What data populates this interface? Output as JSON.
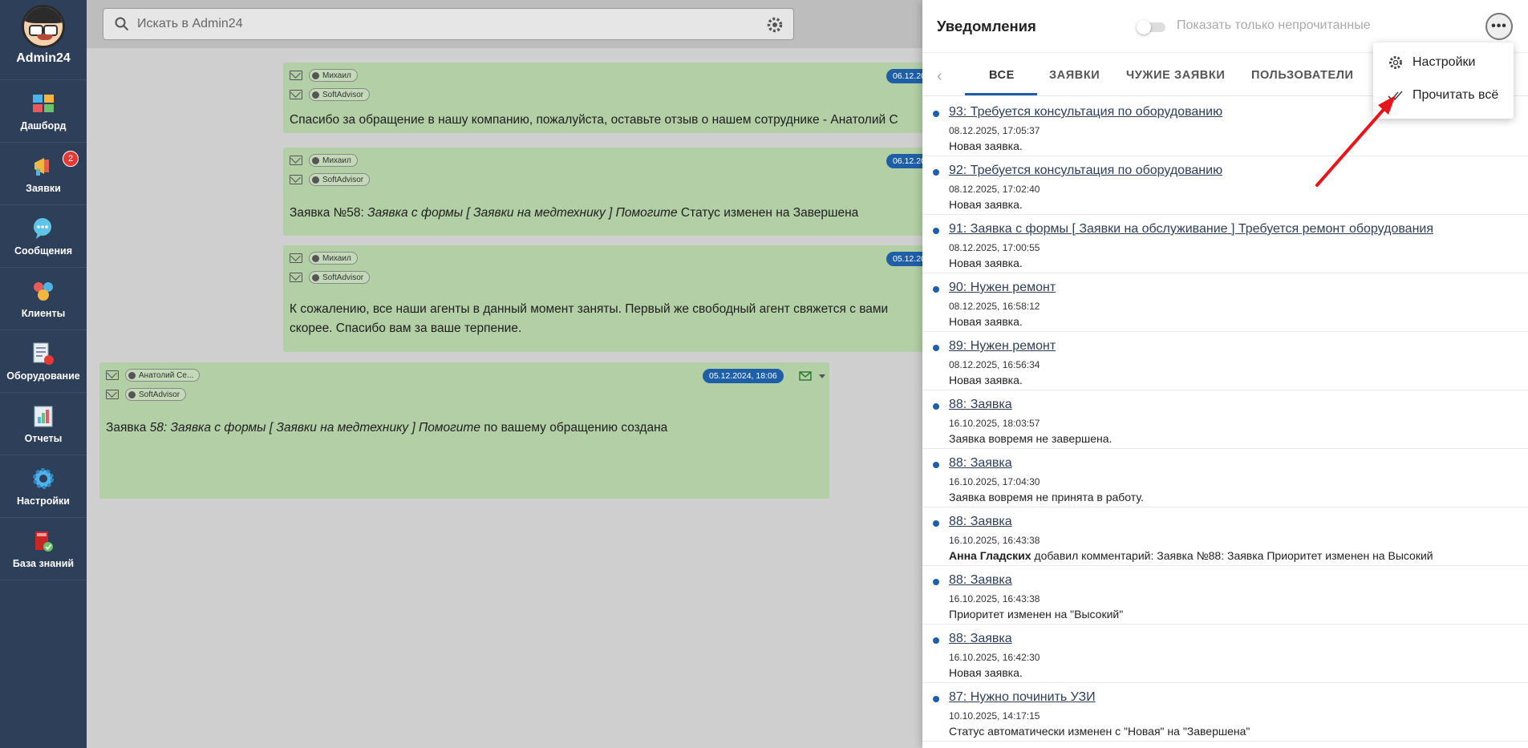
{
  "app": {
    "title": "Admin24"
  },
  "sidebar": {
    "items": [
      {
        "label": "Дашборд",
        "icon": "dashboard-icon"
      },
      {
        "label": "Заявки",
        "icon": "megaphone-icon",
        "badge": "2"
      },
      {
        "label": "Сообщения",
        "icon": "chat-bubble-icon"
      },
      {
        "label": "Клиенты",
        "icon": "clients-icon"
      },
      {
        "label": "Оборудование",
        "icon": "equipment-icon"
      },
      {
        "label": "Отчеты",
        "icon": "reports-icon"
      },
      {
        "label": "Настройки",
        "icon": "gear-icon"
      },
      {
        "label": "База знаний",
        "icon": "knowledge-base-icon"
      }
    ]
  },
  "search": {
    "placeholder": "Искать в Admin24"
  },
  "chat": {
    "messages": [
      {
        "from": "Михаил",
        "to": "SoftAdvisor",
        "date": "06.12.20",
        "text": "Спасибо за обращение в нашу компанию, пожалуйста, оставьте отзыв о нашем сотруднике - Анатолий С"
      },
      {
        "from": "Михаил",
        "to": "SoftAdvisor",
        "date": "06.12.20",
        "text_prefix": "Заявка №58: ",
        "text_italic": "Заявка с формы [ Заявки на медтехнику ] Помогите",
        "text_suffix": " Статус изменен на Завершена"
      },
      {
        "from": "Михаил",
        "to": "SoftAdvisor",
        "date": "05.12.20",
        "text_line1": "К сожалению, все наши агенты в данный момент заняты. Первый же свободный агент свяжется с вами",
        "text_line2": "скорее. Спасибо вам за ваше терпение."
      },
      {
        "from": "Анатолий Се...",
        "to": "SoftAdvisor",
        "date": "05.12.2024, 18:06",
        "text_prefix": "Заявка ",
        "text_italic": "58: Заявка с формы [ Заявки на медтехнику ] Помогите",
        "text_suffix": " по вашему обращению создана"
      }
    ]
  },
  "notifications": {
    "title": "Уведомления",
    "toggle_label": "Показать только непрочитанные",
    "more_label": "•••",
    "tabs": [
      "ВСЕ",
      "ЗАЯВКИ",
      "ЧУЖИЕ ЗАЯВКИ",
      "ПОЛЬЗОВАТЕЛИ"
    ],
    "items": [
      {
        "title": "93: Требуется консультация по оборудованию",
        "time": "08.12.2025, 17:05:37",
        "desc": "Новая заявка."
      },
      {
        "title": "92: Требуется консультация по оборудованию",
        "time": "08.12.2025, 17:02:40",
        "desc": "Новая заявка."
      },
      {
        "title": "91: Заявка с формы [ Заявки на обслуживание ] Требуется ремонт оборудования",
        "time": "08.12.2025, 17:00:55",
        "desc": "Новая заявка."
      },
      {
        "title": "90: Нужен ремонт",
        "time": "08.12.2025, 16:58:12",
        "desc": "Новая заявка."
      },
      {
        "title": "89: Нужен ремонт",
        "time": "08.12.2025, 16:56:34",
        "desc": "Новая заявка."
      },
      {
        "title": "88: Заявка",
        "time": "16.10.2025, 18:03:57",
        "desc": "Заявка вовремя не завершена."
      },
      {
        "title": "88: Заявка",
        "time": "16.10.2025, 17:04:30",
        "desc": "Заявка вовремя не принята в работу."
      },
      {
        "title": "88: Заявка",
        "time": "16.10.2025, 16:43:38",
        "desc_bold": "Анна Гладских",
        "desc": " добавил комментарий: Заявка №88: Заявка Приоритет изменен на Высокий"
      },
      {
        "title": "88: Заявка",
        "time": "16.10.2025, 16:43:38",
        "desc": "Приоритет изменен на \"Высокий\""
      },
      {
        "title": "88: Заявка",
        "time": "16.10.2025, 16:42:30",
        "desc": "Новая заявка."
      },
      {
        "title": "87: Нужно починить УЗИ",
        "time": "10.10.2025, 14:17:15",
        "desc": "Статус автоматически изменен с \"Новая\" на \"Завершена\""
      }
    ]
  },
  "menu": {
    "items": [
      {
        "label": "Настройки",
        "icon": "gear-icon"
      },
      {
        "label": "Прочитать всё",
        "icon": "double-check-icon"
      }
    ]
  },
  "colors": {
    "sidebar": "#2e3f59",
    "accent": "#1e5fa8",
    "message_bg": "#b2cfa5",
    "badge": "#e53935",
    "annotation_arrow": "#e8141b"
  }
}
